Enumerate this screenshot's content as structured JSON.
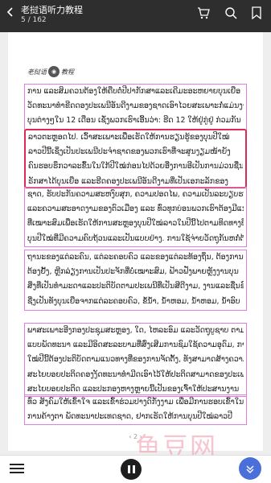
{
  "header": {
    "title": "老挝语听力教程",
    "page_indicator": "5 / 162"
  },
  "logo": {
    "text_left": "老挝语",
    "text_right": "教程"
  },
  "paragraphs": [
    {
      "lines": [
        "ການ  ແລະສິມຄວນຕ້ອງໃຫ້ຄືບຕໍ່ປີປາກັກສາແລະເຄີມະອະຫຍາຍບຸນເຍືອ",
        "ວັດທະນາທໍາຂີດດອງປະເພນີອັນດີງາມຂອງຊາດເອົາໄວຍສະເພາະກໍ່ແມ່ນງານ",
        "ບຸນຕ່າງໆໃນ 12 ເດືອນ ເຊັ່ງພວກເຮົາເອີ້ນວ່າ: ຮີດ 12 ໃຫ້ຢູ່ກູ່ຢູ່ ກ່ວມກັນ",
        "ລາວຕະຫຼອດໄປ."
      ],
      "selected": false
    },
    {
      "lines": [
        "ລາວຕະຫຼອດໄປ.   ເວົ້າສະເພາະເພື່ອເຮັດໃຫ້ການຮຽນຮູ້ຂອງບຸນປີໃໝ່",
        "ລາວປີນີ້ເຊິ່ງເປັນປະເພນີປະຈໍາຊາດຂອງພວກເຮົາທີ່ຈະສູນງຽມໜ້າຍັງ",
        "ຄົນຮອບຮຶກວາລະຂຶ້ນໃນໃກ້ປີໃໝ່ກ່ອນໄປດ້ວຍອີ່ງການອີເປັນການມ່ວນຊື່ນ,",
        "ຣັກສາໄດ້ບຸນເຍືອ      ແລະຮີດຄອງປະເພນີອັນດີງາມທີ່ເປັນເອກະລັກຂອງ"
      ],
      "selected": true
    },
    {
      "lines": [
        "ຊາດ, ຮັບປະກັນຄວາມສະຫງົບສຸກ, ຄວາມປອດໄພ, ຄວາມເປັນລະບຽບຮຽບຮ້ອຍ",
        "ແລະຄວາມສະອາດງາມຂອງຕົວເມືອງ ແລະ ທົ່ວທຸກບ່ອນພວກເຮົາຕ້ອງມີແນວທາງ",
        "ທີ່ເໝາະສົມເພື່ອເຮັດໃຫ້ການສະຫຼອງບຸນປີໃໝ່ລາວໃນປີນີ້ໄປຕາມທິດທາງທີ່ດີ, ຊັ່ງເປັນ",
        "ບຸນປີໃໝ່ທີ່ມີຄວາມຄົບຖ້ວນແລະເປັນແບບຢ່າງ. ການໃຊ້ຈ່າຍວັດຖຸກັນຫກໍ່ຕ້ອງໃຫ້ເໝາະສົມກັບຖານະແລະ"
      ],
      "selected": false
    },
    {
      "lines": [
        "ຖານະຂອງແຕ່ລະຄົນ, ແຕ່ລະຄອບຄົວ ແລະຂອງແຕ່ລະທ້ອງຖິ່ນ, ຕ້ອງການ",
        "ຕ້ອງຢັ້ງ, ຫຼີກລ່ຽງການເປັນປະຈັກທີ່ບໍ່ເໝາະສົມ, ຟ້າວຟັ່ງພາຍຫຼັງງານບຸນ",
        "ສິ່ງທີ່ເປັນທຳມະດາແລະປະຕິບັດຕາມປະເພນີທີ່ເປັນສີດີງາມ, ງານແລະຊື່ນຊົມ",
        "ຊີ່ງເປັນທັງບຸນເຍືອຈາກແຕ່ລະຄອບຄົວ, ຂໍ້ນໍ້າ, ນ້ຳຫອມ, ນ້ຳຫອມ, ນ້ຳອົບ"
      ],
      "selected": false
    },
    {
      "lines": [
        "ພາສະເພາະອີງກອງປະຊຸມສະຫຼອງ, ໃດ, ໄຫລະອົມ ແລະວັດຖຸບູຊາບ ຕາມຂັດໃຊ້ຕ່າງໆ",
        "ແບບພັດທະນາ ແລະມີອິດສະລະບາມທີ່ສົ່ງເສີມການຊົມໃຊ້ຄວາມອຸດົມ, ການຫຼິ້ນບຸນປີ",
        "ໃໝ່ປີນີ້ຕ້ອງປະຕິບັດຕາມແນວທາງທີ່ຂອງການຈັດຕັ້ງ, ທັງສາມາດສ້າງຄວາມສະຫງົບ",
        "ສະໄຍບອຍປະຕິດຄອງງັດທະນາທຳມີດເອົາໄວ້ໃຫ້ປະຕິດສາມາດຂອງປະເພນີ ແລະເພື່ອໃຫ້ການ",
        "ສະໄຍບອຍປະຕິດ ແລະປະກອງຫາງຫຼາຍນີ້ເປັນຂອງເຈົ້າໃຫ້ປະສານງານ"
      ],
      "selected": false
    },
    {
      "lines": [
        "ທົ່ວ   ສັງຄົມໃຫ້ເຂົ້າໃຈ   ແລະເຂົ້າຮ່ວມປາງດົກັ່ງງາມ   ເພື່ອມີການຮອບເຂົ້າໃນ",
        "ການຄ້າງຕາ  ພັດທະນາປະເທດຊາດ,  ຢາກເຮັດໃຫ້ການບຸນປີໃໝ່ລາວປີ"
      ],
      "selected": false
    }
  ],
  "footer": {
    "page_number": "2"
  },
  "watermark": {
    "text": "鱼豆网"
  },
  "colors": {
    "topbar": "#2e2e2e",
    "paragraph_border": "#e07ee0",
    "selected_border": "#d92b55",
    "accent": "#4a6fd8"
  },
  "icons": {
    "back": "back-arrow-icon",
    "cart": "cart-icon",
    "search": "search-icon",
    "bookmark": "bookmark-icon",
    "menu": "menu-icon",
    "pause": "pause-icon",
    "collapse": "chevron-down-icon"
  }
}
